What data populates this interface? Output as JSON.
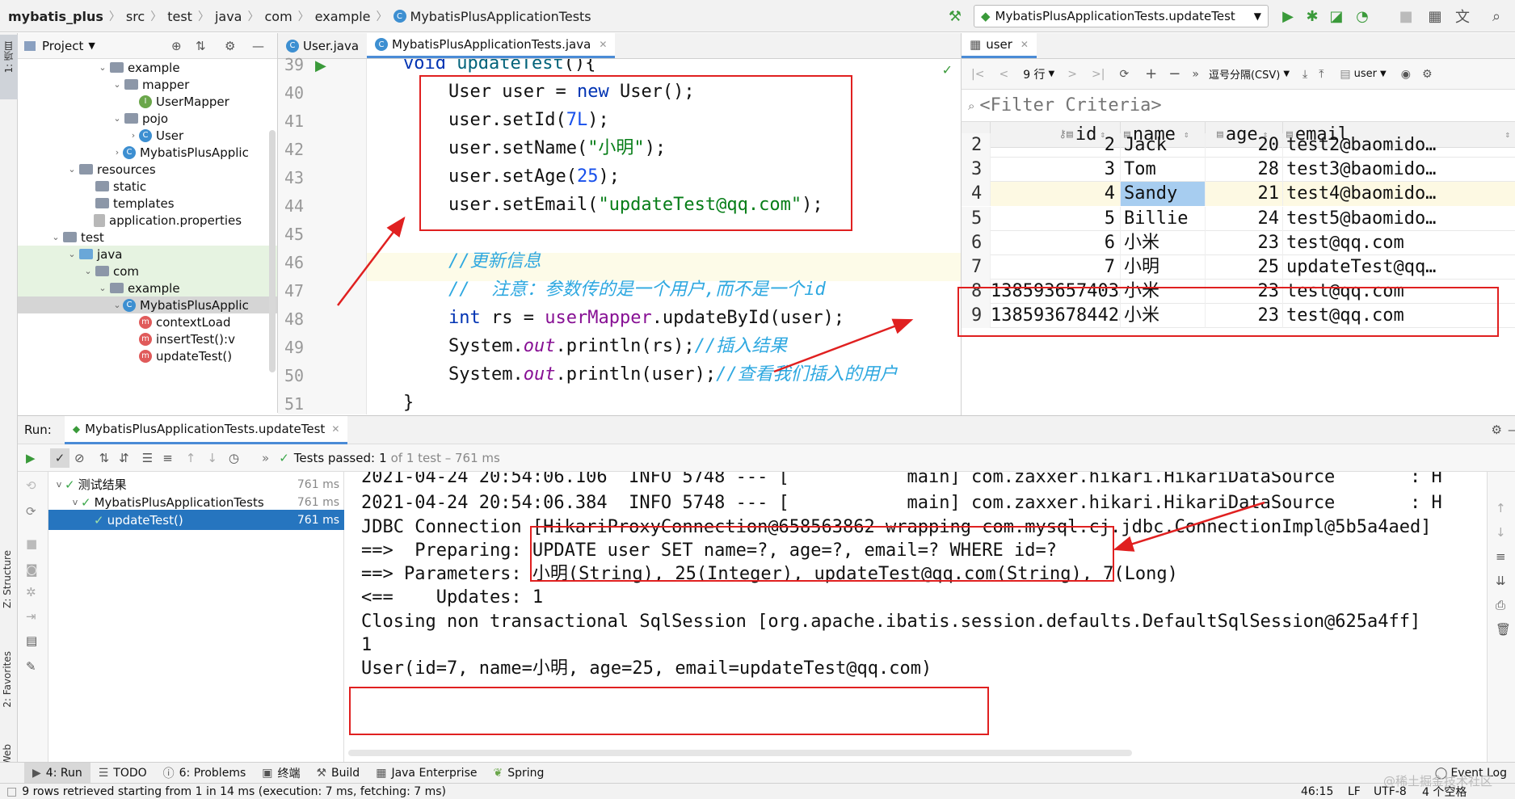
{
  "breadcrumb": [
    "mybatis_plus",
    "src",
    "test",
    "java",
    "com",
    "example",
    "MybatisPlusApplicationTests"
  ],
  "run_config": "MybatisPlusApplicationTests.updateTest",
  "project": {
    "title": "Project",
    "tree": [
      {
        "label": "example",
        "kind": "folder",
        "arrow": "v"
      },
      {
        "label": "mapper",
        "kind": "folder",
        "arrow": "v"
      },
      {
        "label": "UserMapper",
        "kind": "interface",
        "arrow": ""
      },
      {
        "label": "pojo",
        "kind": "folder",
        "arrow": "v"
      },
      {
        "label": "User",
        "kind": "class",
        "arrow": ">"
      },
      {
        "label": "MybatisPlusApplic",
        "kind": "class",
        "arrow": ">"
      },
      {
        "label": "resources",
        "kind": "folder",
        "arrow": "v"
      },
      {
        "label": "static",
        "kind": "folder",
        "arrow": ""
      },
      {
        "label": "templates",
        "kind": "folder",
        "arrow": ""
      },
      {
        "label": "application.properties",
        "kind": "file",
        "arrow": ""
      },
      {
        "label": "test",
        "kind": "folder",
        "arrow": "v"
      },
      {
        "label": "java",
        "kind": "folder",
        "arrow": "v"
      },
      {
        "label": "com",
        "kind": "folder",
        "arrow": "v"
      },
      {
        "label": "example",
        "kind": "folder",
        "arrow": "v"
      },
      {
        "label": "MybatisPlusApplic",
        "kind": "class",
        "arrow": "v"
      },
      {
        "label": "contextLoad",
        "kind": "method",
        "arrow": ""
      },
      {
        "label": "insertTest():v",
        "kind": "method",
        "arrow": ""
      },
      {
        "label": "updateTest()",
        "kind": "method",
        "arrow": ""
      }
    ]
  },
  "editor": {
    "tabs": [
      "User.java",
      "MybatisPlusApplicationTests.java"
    ],
    "line_numbers": [
      "39",
      "40",
      "41",
      "42",
      "43",
      "44",
      "45",
      "46",
      "47",
      "48",
      "49",
      "50",
      "51"
    ]
  },
  "db": {
    "tab": "user",
    "rows_label": "9 行",
    "csv_label": "逗号分隔(CSV)",
    "schema_label": "user",
    "filter_placeholder": "<Filter Criteria>",
    "columns": [
      "id",
      "name",
      "age",
      "email"
    ],
    "rows": [
      [
        "2",
        "2",
        "Jack",
        "20",
        "test2@baomido…"
      ],
      [
        "3",
        "3",
        "Tom",
        "28",
        "test3@baomido…"
      ],
      [
        "4",
        "4",
        "Sandy",
        "21",
        "test4@baomido…"
      ],
      [
        "5",
        "5",
        "Billie",
        "24",
        "test5@baomido…"
      ],
      [
        "6",
        "6",
        "小米",
        "23",
        "test@qq.com"
      ],
      [
        "7",
        "7",
        "小明",
        "25",
        "updateTest@qq…"
      ],
      [
        "8",
        "138593657403…",
        "小米",
        "23",
        "test@qq.com"
      ],
      [
        "9",
        "138593678442…",
        "小米",
        "23",
        "test@qq.com"
      ]
    ]
  },
  "run": {
    "label": "Run:",
    "tab": "MybatisPlusApplicationTests.updateTest",
    "tests_passed": "Tests passed:",
    "tests_count": "1",
    "tests_detail": "of 1 test – 761 ms",
    "tree": [
      {
        "label": "测试结果",
        "ms": "761 ms"
      },
      {
        "label": "MybatisPlusApplicationTests",
        "ms": "761 ms"
      },
      {
        "label": "updateTest()",
        "ms": "761 ms"
      }
    ],
    "console": [
      "2021-04-24 20:54:06.106  INFO 5748 --- [           main] com.zaxxer.hikari.HikariDataSource       : H",
      "2021-04-24 20:54:06.384  INFO 5748 --- [           main] com.zaxxer.hikari.HikariDataSource       : H",
      "JDBC Connection [HikariProxyConnection@658563862 wrapping com.mysql.cj.jdbc.ConnectionImpl@5b5a4aed]",
      "==>  Preparing: UPDATE user SET name=?, age=?, email=? WHERE id=?",
      "==> Parameters: 小明(String), 25(Integer), updateTest@qq.com(String), 7(Long)",
      "<==    Updates: 1",
      "Closing non transactional SqlSession [org.apache.ibatis.session.defaults.DefaultSqlSession@625a4ff]",
      "1",
      "User(id=7, name=小明, age=25, email=updateTest@qq.com)"
    ]
  },
  "side_labels": {
    "project": "1: 项目",
    "structure": "Z: Structure",
    "favorites": "2: Favorites",
    "web": "Web"
  },
  "bottom_tabs": [
    "4: Run",
    "TODO",
    "6: Problems",
    "终端",
    "Build",
    "Java Enterprise",
    "Spring"
  ],
  "bottom_right": "Event Log",
  "status": {
    "left": "9 rows retrieved starting from 1 in 14 ms (execution: 7 ms, fetching: 7 ms)",
    "position": "46:15",
    "line_sep": "LF",
    "encoding": "UTF-8",
    "indent": "4 个空格"
  },
  "watermark": "@稀土掘金技术社区"
}
